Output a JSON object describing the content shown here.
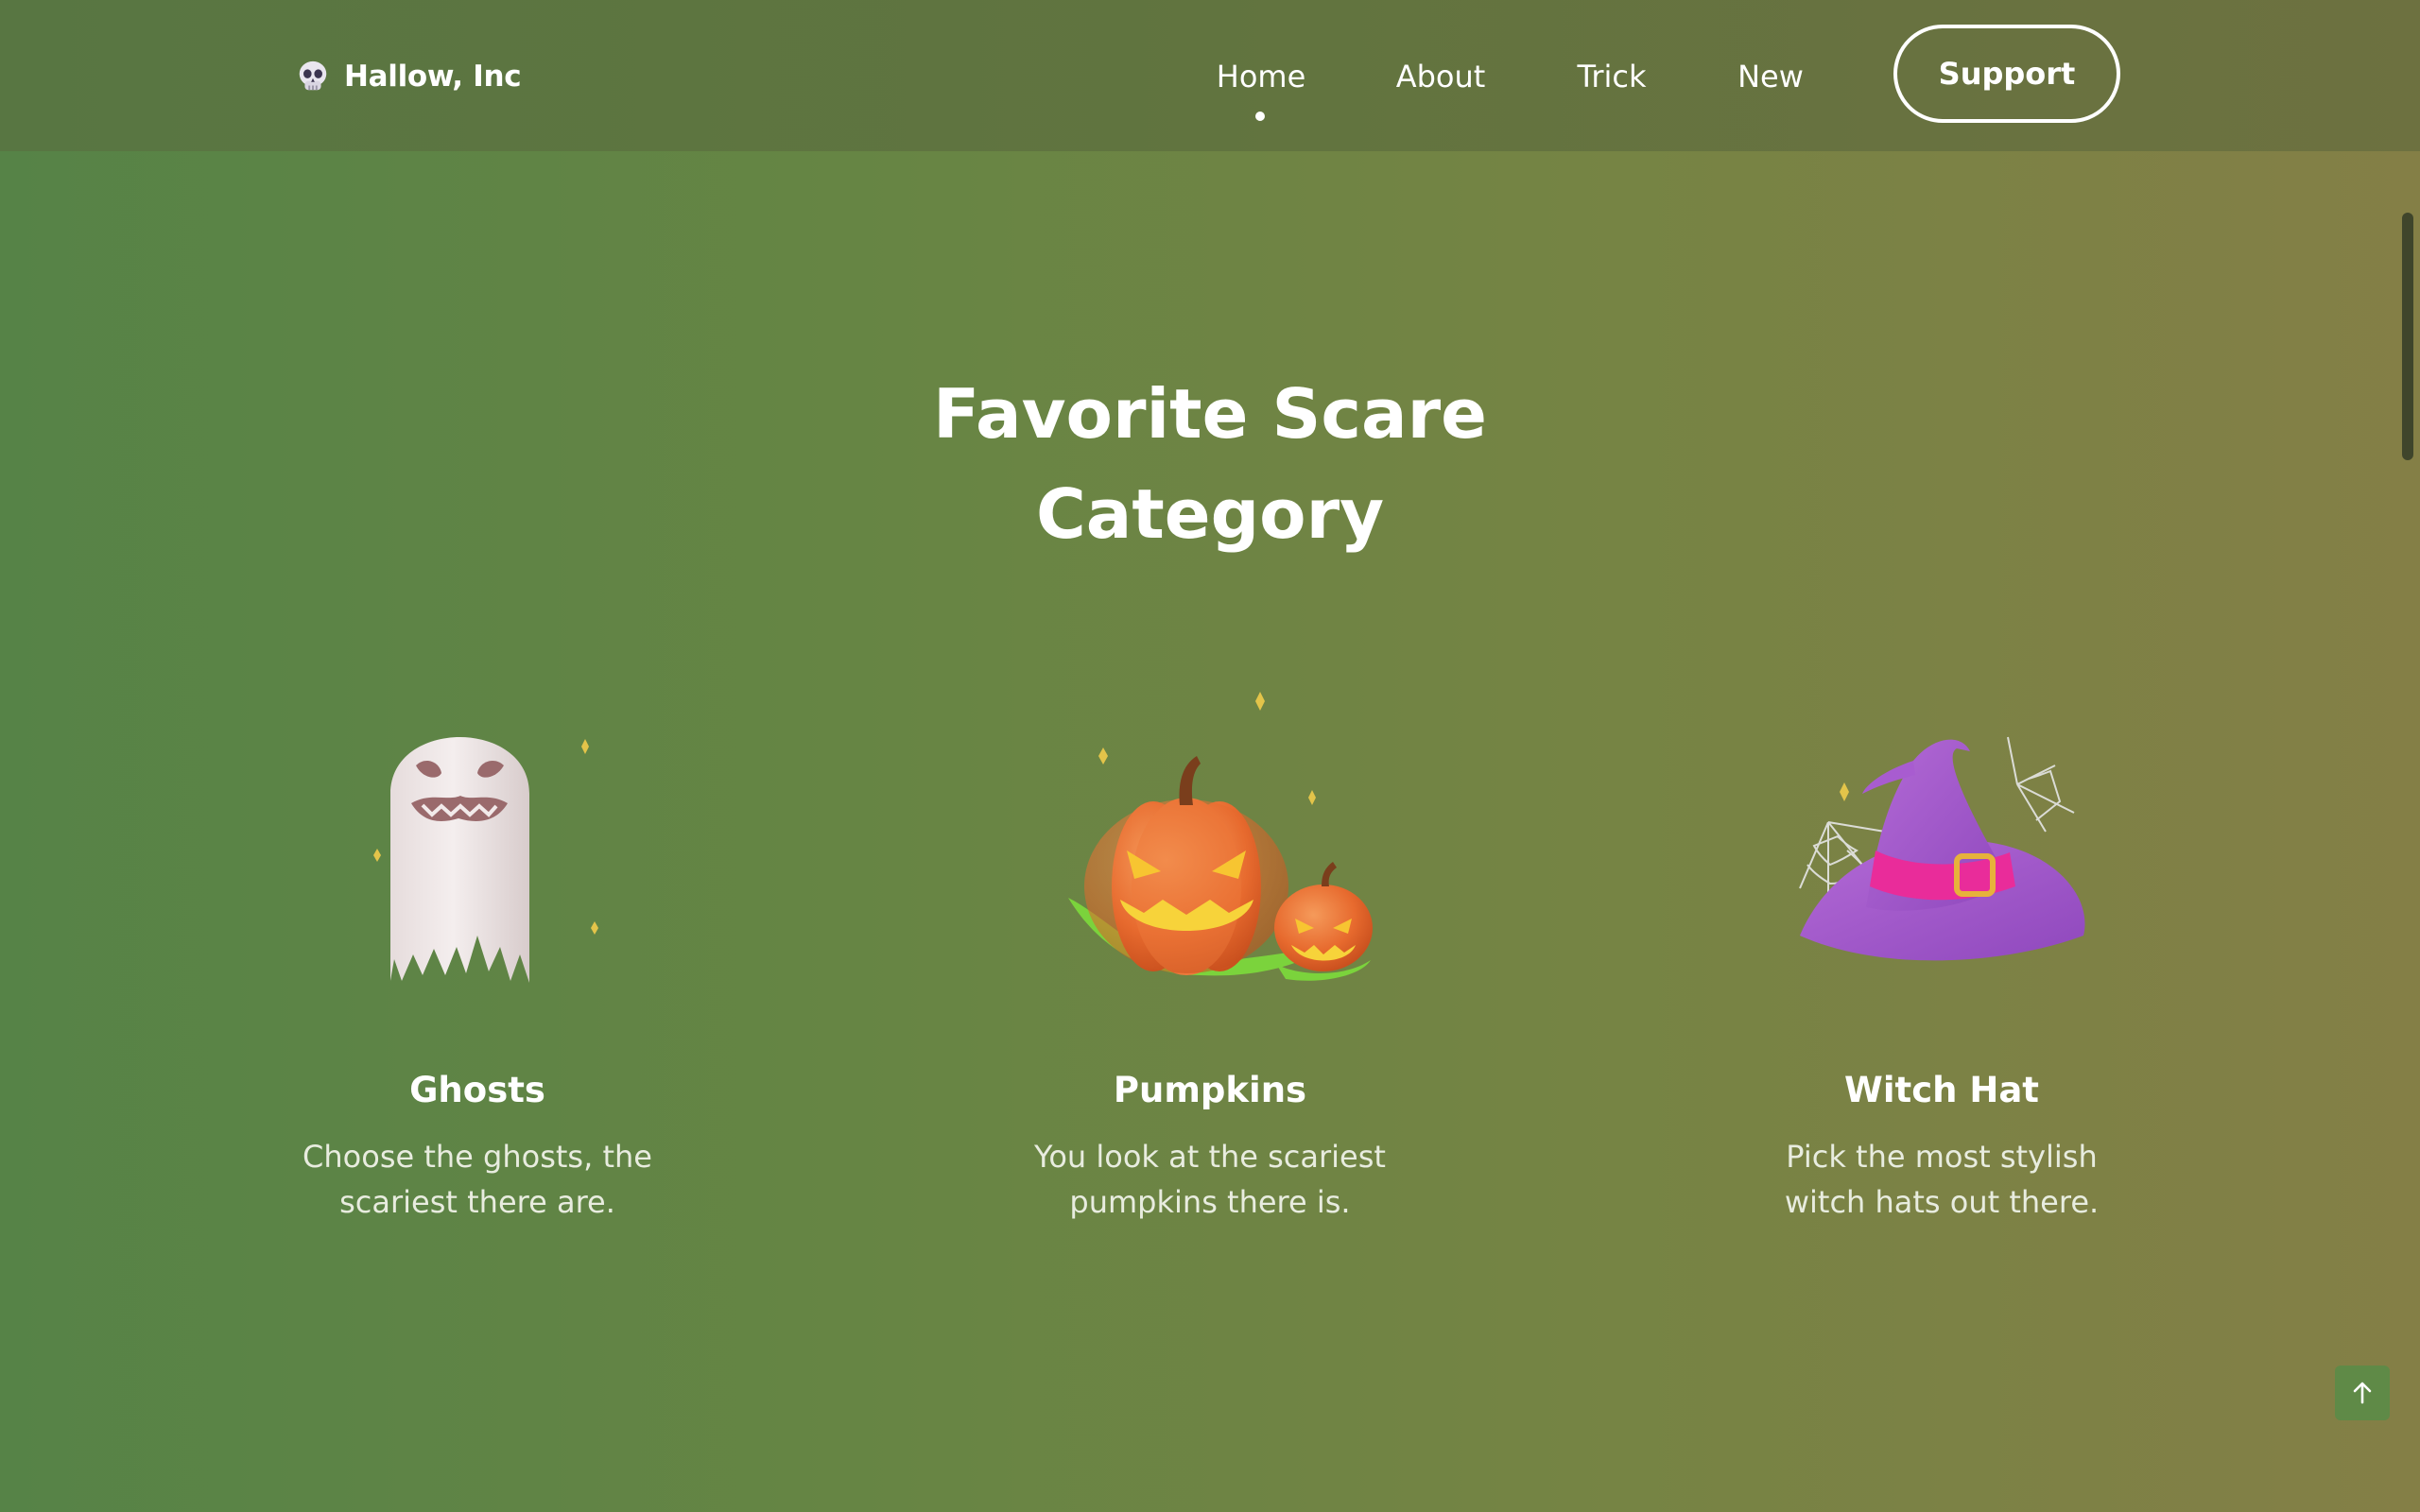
{
  "brand": {
    "name": "Hallow, Inc",
    "logo_icon": "skull-icon"
  },
  "nav": {
    "items": [
      {
        "label": "Home",
        "active": true
      },
      {
        "label": "About",
        "active": false
      },
      {
        "label": "Trick",
        "active": false
      },
      {
        "label": "New",
        "active": false
      }
    ],
    "support_label": "Support"
  },
  "section": {
    "title_line1": "Favorite Scare",
    "title_line2": "Category"
  },
  "categories": [
    {
      "title": "Ghosts",
      "description": "Choose the ghosts, the scariest there are.",
      "icon": "ghost-icon"
    },
    {
      "title": "Pumpkins",
      "description": "You look at the scariest pumpkins there is.",
      "icon": "pumpkin-icon"
    },
    {
      "title": "Witch Hat",
      "description": "Pick the most stylish witch hats out there.",
      "icon": "witch-hat-icon"
    }
  ],
  "back_to_top_icon": "arrow-up-icon",
  "colors": {
    "background_start": "#568347",
    "background_end": "#847f46",
    "text": "#ffffff"
  }
}
